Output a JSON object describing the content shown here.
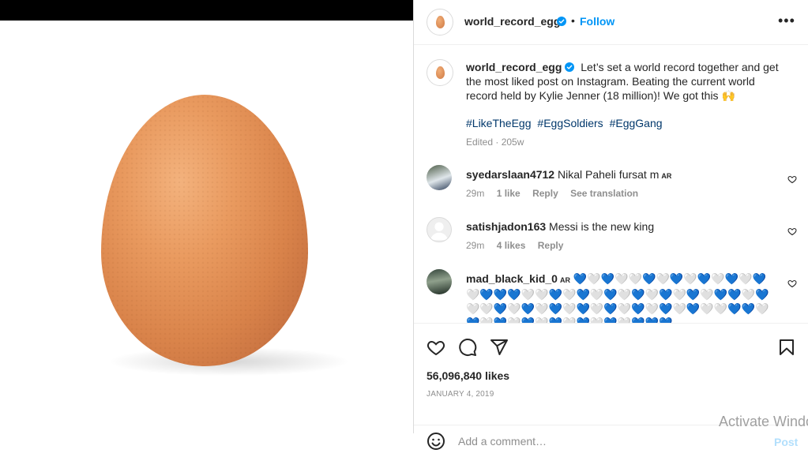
{
  "header": {
    "username": "world_record_egg",
    "follow_label": "Follow",
    "separator": "•",
    "more_label": "•••"
  },
  "caption": {
    "username": "world_record_egg",
    "text": "Let’s set a world record together and get the most liked post on Instagram. Beating the current world record held by Kylie Jenner (18 million)! We got this",
    "emoji": "🙌",
    "hashtags": [
      "#LikeTheEgg",
      "#EggSoldiers",
      "#EggGang"
    ],
    "edited": "Edited · 205w"
  },
  "comments": [
    {
      "username": "syedarslaan4712",
      "text": "Nikal Paheli fursat m",
      "badge": "AR",
      "time": "29m",
      "likes": "1 like",
      "reply": "Reply",
      "translate": "See translation"
    },
    {
      "username": "satishjadon163",
      "text": "Messi is the new king",
      "time": "29m",
      "likes": "4 likes",
      "reply": "Reply"
    },
    {
      "username": "mad_black_kid_0",
      "badge": "AR",
      "hearts": "💙🤍💙🤍🤍💙🤍💙🤍💙🤍💙🤍💙🤍💙💙💙🤍🤍💙🤍💙🤍💙🤍💙🤍💙🤍💙🤍💙💙🤍💙🤍🤍💙🤍💙🤍💙🤍💙🤍💙🤍💙🤍💙🤍💙🤍🤍💙💙🤍💙🤍💙🤍💙🤍💙🤍💙🤍💙🤍💙💙💙"
    }
  ],
  "post": {
    "likes": "56,096,840 likes",
    "date": "JANUARY 4, 2019",
    "comment_placeholder": "Add a comment…",
    "post_label": "Post"
  },
  "watermark": "Activate Windows",
  "colors": {
    "accent": "#0095f6",
    "hashtag": "#00376b",
    "muted": "#8e8e8e"
  }
}
